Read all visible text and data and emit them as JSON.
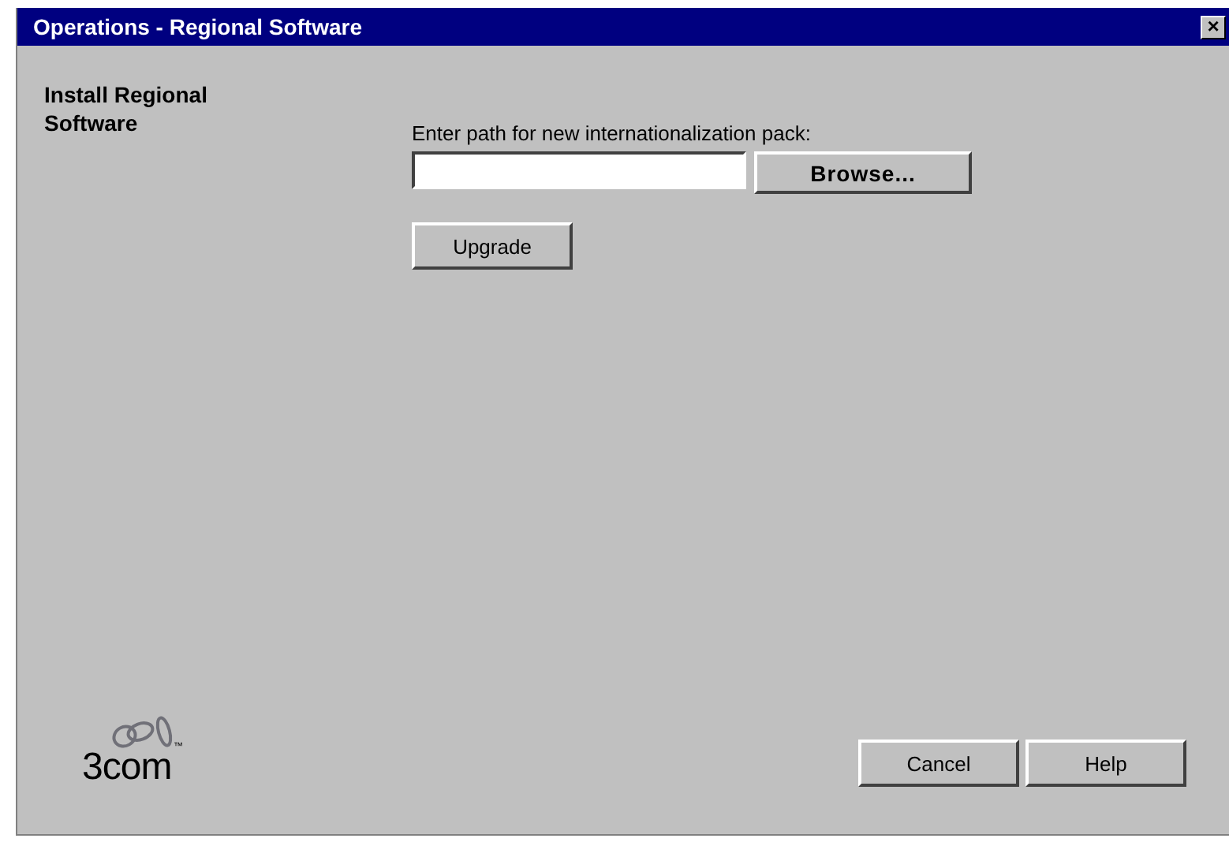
{
  "window": {
    "title": "Operations - Regional Software",
    "close": "×"
  },
  "heading": "Install Regional Software",
  "path_label": "Enter path for new internationalization pack:",
  "browse_button": "Browse...",
  "upgrade_button": "Upgrade",
  "logo": {
    "text": "3com",
    "trademark": "™"
  },
  "buttons": [
    "Cancel",
    "Help"
  ]
}
